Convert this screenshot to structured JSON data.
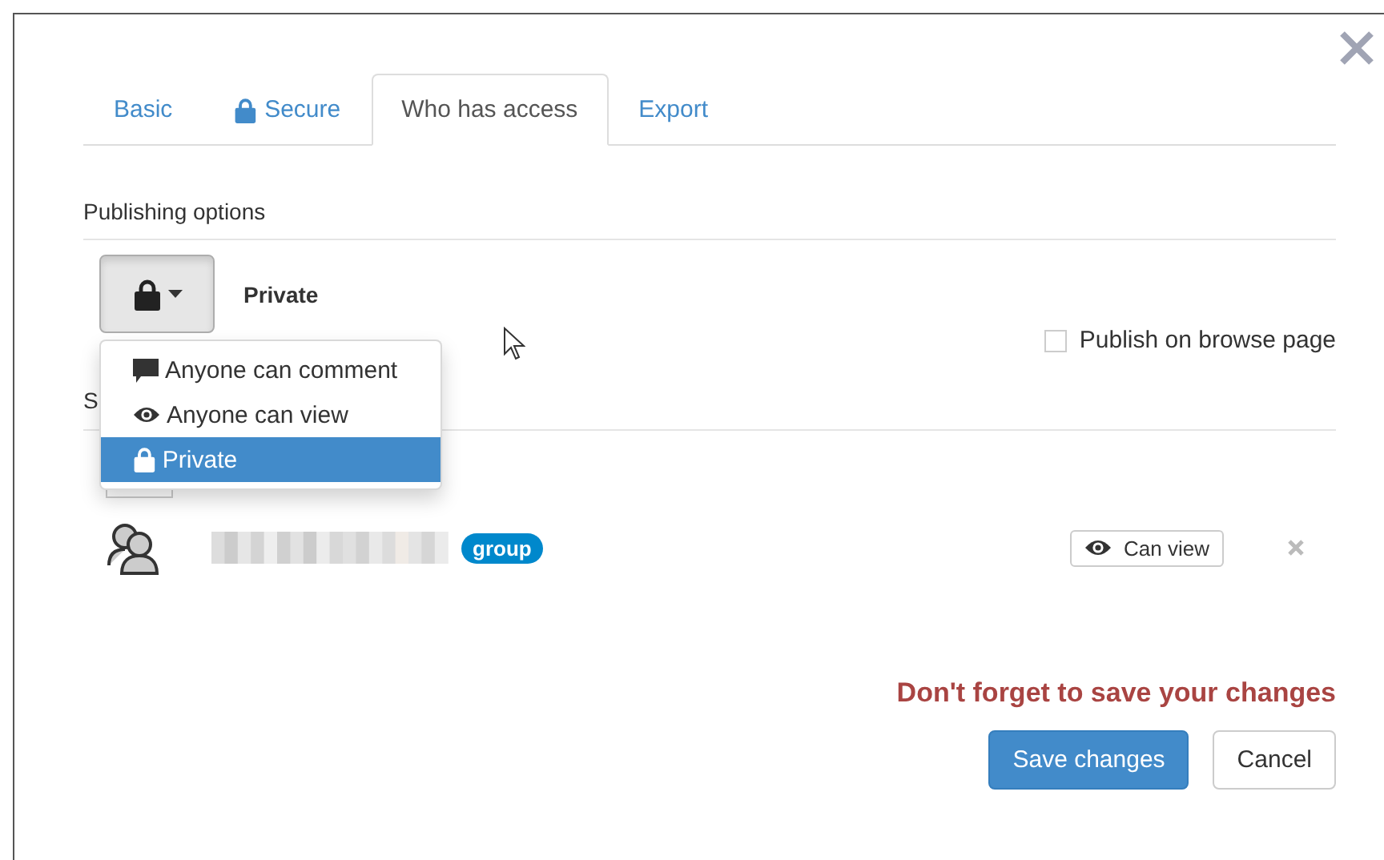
{
  "tabs": [
    {
      "label": "Basic",
      "kind": "plain",
      "selected": false
    },
    {
      "label": "Secure",
      "kind": "locked",
      "selected": false
    },
    {
      "label": "Who has access",
      "kind": "plain",
      "selected": true
    },
    {
      "label": "Export",
      "kind": "plain",
      "selected": false
    }
  ],
  "publishing": {
    "heading": "Publishing options",
    "current": "Private",
    "publish_on_browse": {
      "label": "Publish on browse page",
      "checked": false
    },
    "menu": [
      {
        "label": "Anyone can comment",
        "kind": "comment",
        "selected": false
      },
      {
        "label": "Anyone can view",
        "kind": "view",
        "selected": false
      },
      {
        "label": "Private",
        "kind": "private",
        "selected": true
      }
    ]
  },
  "sharing": {
    "heading": "S",
    "entries": [
      {
        "badge": "group",
        "permission": "Can view"
      }
    ]
  },
  "warning": "Don't forget to save your changes",
  "buttons": [
    {
      "label": "Save changes",
      "kind": "primary"
    },
    {
      "label": "Cancel",
      "kind": "default"
    }
  ]
}
